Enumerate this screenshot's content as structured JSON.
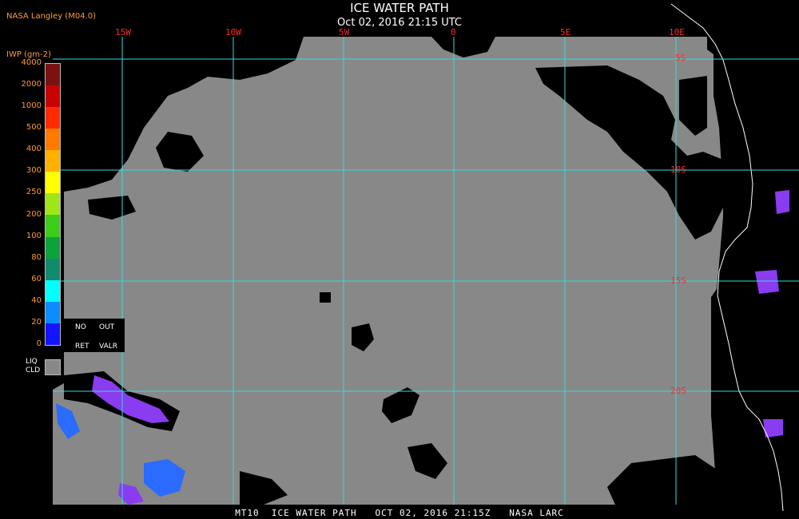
{
  "header": {
    "title": "ICE WATER PATH",
    "subtitle": "Oct 02, 2016 21:15 UTC",
    "source": "NASA Langley (M04.0)"
  },
  "footer": {
    "caption": "MT10  ICE WATER PATH   OCT 02, 2016 21:15Z   NASA LARC"
  },
  "map": {
    "longitude_labels": [
      "15W",
      "10W",
      "5W",
      "0",
      "5E",
      "10E"
    ],
    "latitude_labels": [
      "5S",
      "10S",
      "15S",
      "20S"
    ],
    "colors": {
      "liquid_cloud": "#888888",
      "clear": "#000000",
      "grid": "#33dddd",
      "coast": "#ffffff",
      "ice_light": "#8a3cf0",
      "ice_mid": "#2b6bff",
      "grid_label": "#ff2a2a"
    }
  },
  "legend": {
    "unit": "IWP (gm-2)",
    "levels": [
      {
        "label": "4000",
        "color": "#7a1212"
      },
      {
        "label": "2000",
        "color": "#c80000"
      },
      {
        "label": "1000",
        "color": "#ff2a00"
      },
      {
        "label": "500",
        "color": "#ff7a00"
      },
      {
        "label": "400",
        "color": "#ffb000"
      },
      {
        "label": "300",
        "color": "#ffff00"
      },
      {
        "label": "250",
        "color": "#9ee51a"
      },
      {
        "label": "200",
        "color": "#3ccc1a"
      },
      {
        "label": "100",
        "color": "#0da23c"
      },
      {
        "label": "80",
        "color": "#128a6e"
      },
      {
        "label": "60",
        "color": "#00ffff"
      },
      {
        "label": "40",
        "color": "#0a8cff"
      },
      {
        "label": "20",
        "color": "#1414ff"
      },
      {
        "label": "0",
        "color": "#8a2be2"
      }
    ],
    "no_ret": "NO",
    "no_ret_2": "RET",
    "out": "OUT",
    "out_2": "VALR",
    "liq": "LIQ",
    "cld": "CLD"
  }
}
